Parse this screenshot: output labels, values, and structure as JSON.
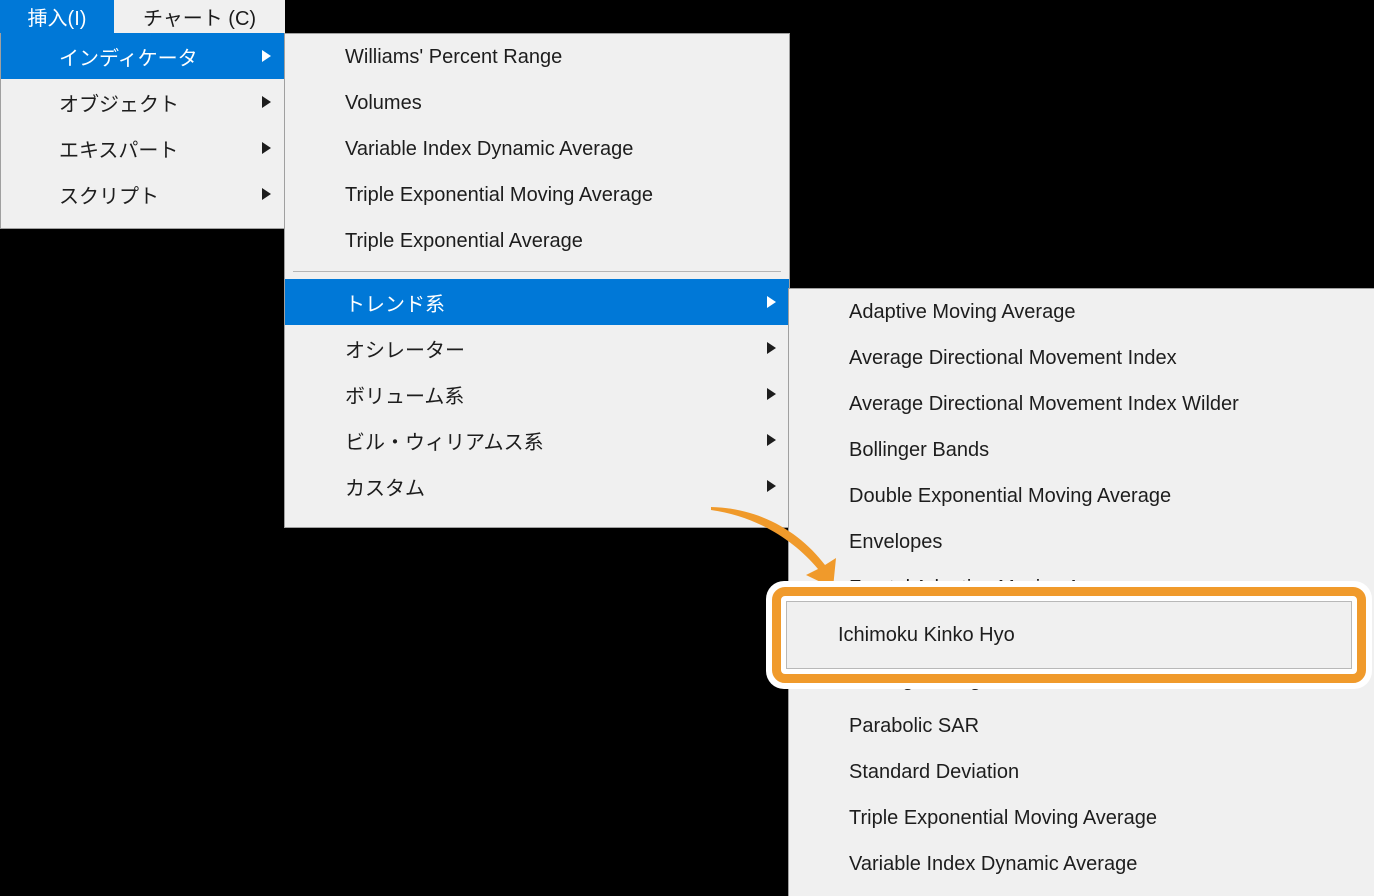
{
  "app": {
    "accent_blue": "#0078D7",
    "panel_bg": "#F0F0F0",
    "text_color": "#1D1D1D",
    "callout_orange": "#F09A2B",
    "backdrop": "#000000"
  },
  "menubar": {
    "items": [
      {
        "label": "挿入(I)",
        "selected": true
      },
      {
        "label": "チャート (C)",
        "selected": false
      }
    ]
  },
  "insert_menu": {
    "items": [
      {
        "label": "インディケータ",
        "selected": true,
        "has_submenu": true
      },
      {
        "label": "オブジェクト",
        "selected": false,
        "has_submenu": true
      },
      {
        "label": "エキスパート",
        "selected": false,
        "has_submenu": true
      },
      {
        "label": "スクリプト",
        "selected": false,
        "has_submenu": true
      }
    ]
  },
  "indicators_menu": {
    "top_items": [
      {
        "label": "Williams' Percent Range",
        "selected": false,
        "has_submenu": false
      },
      {
        "label": "Volumes",
        "selected": false,
        "has_submenu": false
      },
      {
        "label": "Variable Index Dynamic Average",
        "selected": false,
        "has_submenu": false
      },
      {
        "label": "Triple Exponential Moving Average",
        "selected": false,
        "has_submenu": false
      },
      {
        "label": "Triple Exponential Average",
        "selected": false,
        "has_submenu": false
      }
    ],
    "category_items": [
      {
        "label": "トレンド系",
        "selected": true,
        "has_submenu": true
      },
      {
        "label": "オシレーター",
        "selected": false,
        "has_submenu": true
      },
      {
        "label": "ボリューム系",
        "selected": false,
        "has_submenu": true
      },
      {
        "label": "ビル・ウィリアムス系",
        "selected": false,
        "has_submenu": true
      },
      {
        "label": "カスタム",
        "selected": false,
        "has_submenu": true
      }
    ]
  },
  "trend_menu": {
    "items": [
      {
        "label": "Adaptive Moving Average",
        "selected": false
      },
      {
        "label": "Average Directional Movement Index",
        "selected": false
      },
      {
        "label": "Average Directional Movement Index Wilder",
        "selected": false
      },
      {
        "label": "Bollinger Bands",
        "selected": false
      },
      {
        "label": "Double Exponential Moving Average",
        "selected": false
      },
      {
        "label": "Envelopes",
        "selected": false
      },
      {
        "label": "Fractal Adaptive Moving Average",
        "selected": false
      },
      {
        "label": "Ichimoku Kinko Hyo",
        "selected": false
      },
      {
        "label": "Moving Average",
        "selected": false
      },
      {
        "label": "Parabolic SAR",
        "selected": false
      },
      {
        "label": "Standard Deviation",
        "selected": false
      },
      {
        "label": "Triple Exponential Moving Average",
        "selected": false
      },
      {
        "label": "Variable Index Dynamic Average",
        "selected": false
      }
    ]
  },
  "callout": {
    "highlighted_label": "Ichimoku Kinko Hyo",
    "arrow": "curved-arrow-icon"
  }
}
